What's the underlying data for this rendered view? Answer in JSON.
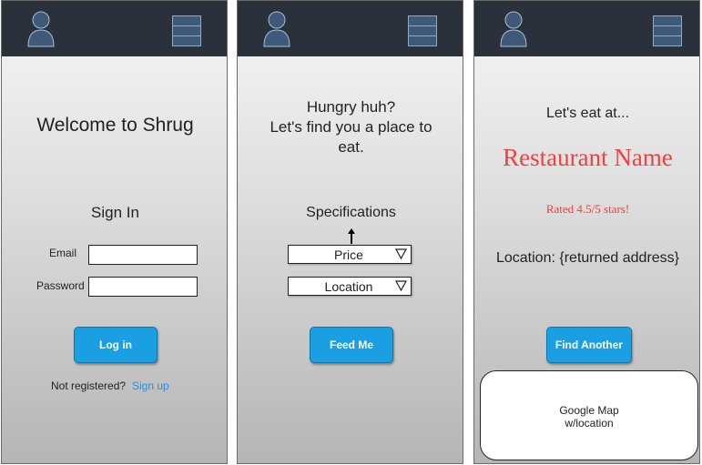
{
  "screens": {
    "login": {
      "title": "Welcome to Shrug",
      "heading": "Sign In",
      "email_label": "Email",
      "password_label": "Password",
      "email_value": "",
      "password_value": "",
      "button_label": "Log in",
      "not_registered_text": "Not registered?",
      "signup_link": "Sign up"
    },
    "search": {
      "title_line1": "Hungry huh?",
      "title_line2": "Let's find you a place to",
      "title_line3": "eat.",
      "heading": "Specifications",
      "price_label": "Price",
      "location_label": "Location",
      "button_label": "Feed Me"
    },
    "result": {
      "intro": "Let's eat at...",
      "restaurant_name": "Restaurant Name",
      "rating_text": "Rated 4.5/5 stars!",
      "location_text": "Location: {returned address}",
      "button_label": "Find Another",
      "map_line1": "Google Map",
      "map_line2": "w/location"
    }
  },
  "icons": {
    "avatar": "user-avatar-icon",
    "menu": "hamburger-menu-icon",
    "dropdown": "triangle-down-icon",
    "arrow": "arrow-up-icon"
  },
  "colors": {
    "topbar": "#2b313b",
    "button": "#1aa0e2",
    "link": "#2a8fde",
    "restaurant_name": "#f04040"
  }
}
